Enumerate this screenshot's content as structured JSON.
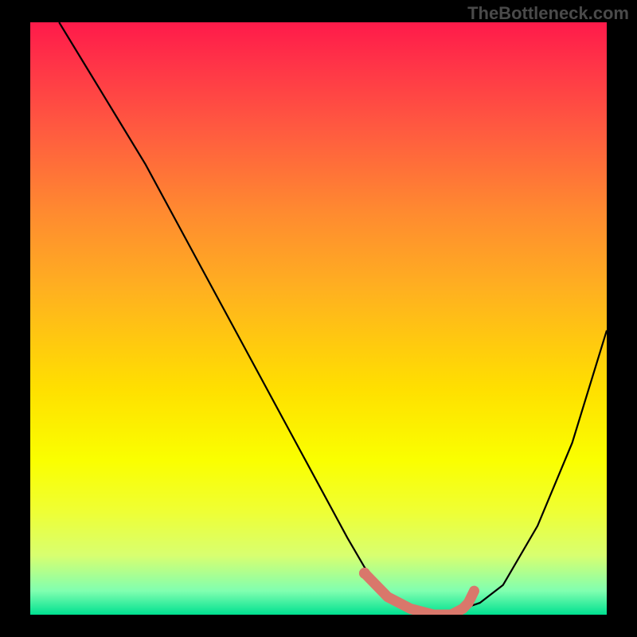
{
  "watermark": "TheBottleneck.com",
  "chart_data": {
    "type": "line",
    "title": "",
    "xlabel": "",
    "ylabel": "",
    "xlim": [
      0,
      100
    ],
    "ylim": [
      0,
      100
    ],
    "series": [
      {
        "name": "bottleneck-curve",
        "x": [
          5,
          10,
          15,
          20,
          25,
          30,
          35,
          40,
          45,
          50,
          55,
          58,
          60,
          63,
          66,
          70,
          73,
          75,
          78,
          82,
          88,
          94,
          100
        ],
        "values": [
          100,
          92,
          84,
          76,
          67,
          58,
          49,
          40,
          31,
          22,
          13,
          8,
          5,
          2,
          1,
          0,
          0,
          1,
          2,
          5,
          15,
          29,
          48
        ]
      }
    ],
    "highlight": {
      "name": "optimal-range",
      "x": [
        58,
        62,
        66,
        70,
        73,
        75,
        76,
        77
      ],
      "values": [
        7,
        3,
        1,
        0,
        0,
        1,
        2,
        4
      ]
    },
    "gradient_stops": [
      {
        "pos": 0,
        "color": "#ff1a4a"
      },
      {
        "pos": 50,
        "color": "#ffb020"
      },
      {
        "pos": 75,
        "color": "#ffff00"
      },
      {
        "pos": 100,
        "color": "#00e090"
      }
    ]
  }
}
